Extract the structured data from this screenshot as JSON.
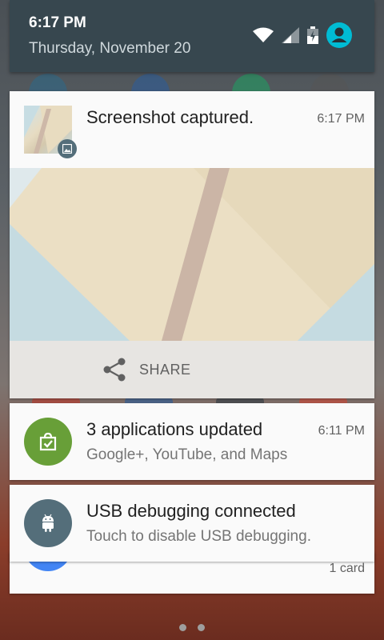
{
  "status": {
    "time": "6:17 PM",
    "date": "Thursday, November 20",
    "icons": [
      "wifi-icon",
      "cell-signal-icon",
      "battery-icon",
      "user-avatar-icon"
    ],
    "avatar_color": "#00bcd4"
  },
  "notifications": {
    "screenshot": {
      "title": "Screenshot captured.",
      "time": "6:17 PM",
      "action_label": "SHARE",
      "icon": "image-icon"
    },
    "apps_updated": {
      "title": "3 applications updated",
      "subtitle": "Google+, YouTube, and Maps",
      "time": "6:11 PM",
      "icon": "play-store-update-icon",
      "icon_color": "#689f38"
    },
    "usb": {
      "title": "USB debugging connected",
      "subtitle": "Touch to disable USB debugging.",
      "icon": "android-icon",
      "icon_color": "#546e7a"
    },
    "stacked": {
      "count_label": "1 card"
    }
  },
  "pager": {
    "pages": 2
  }
}
